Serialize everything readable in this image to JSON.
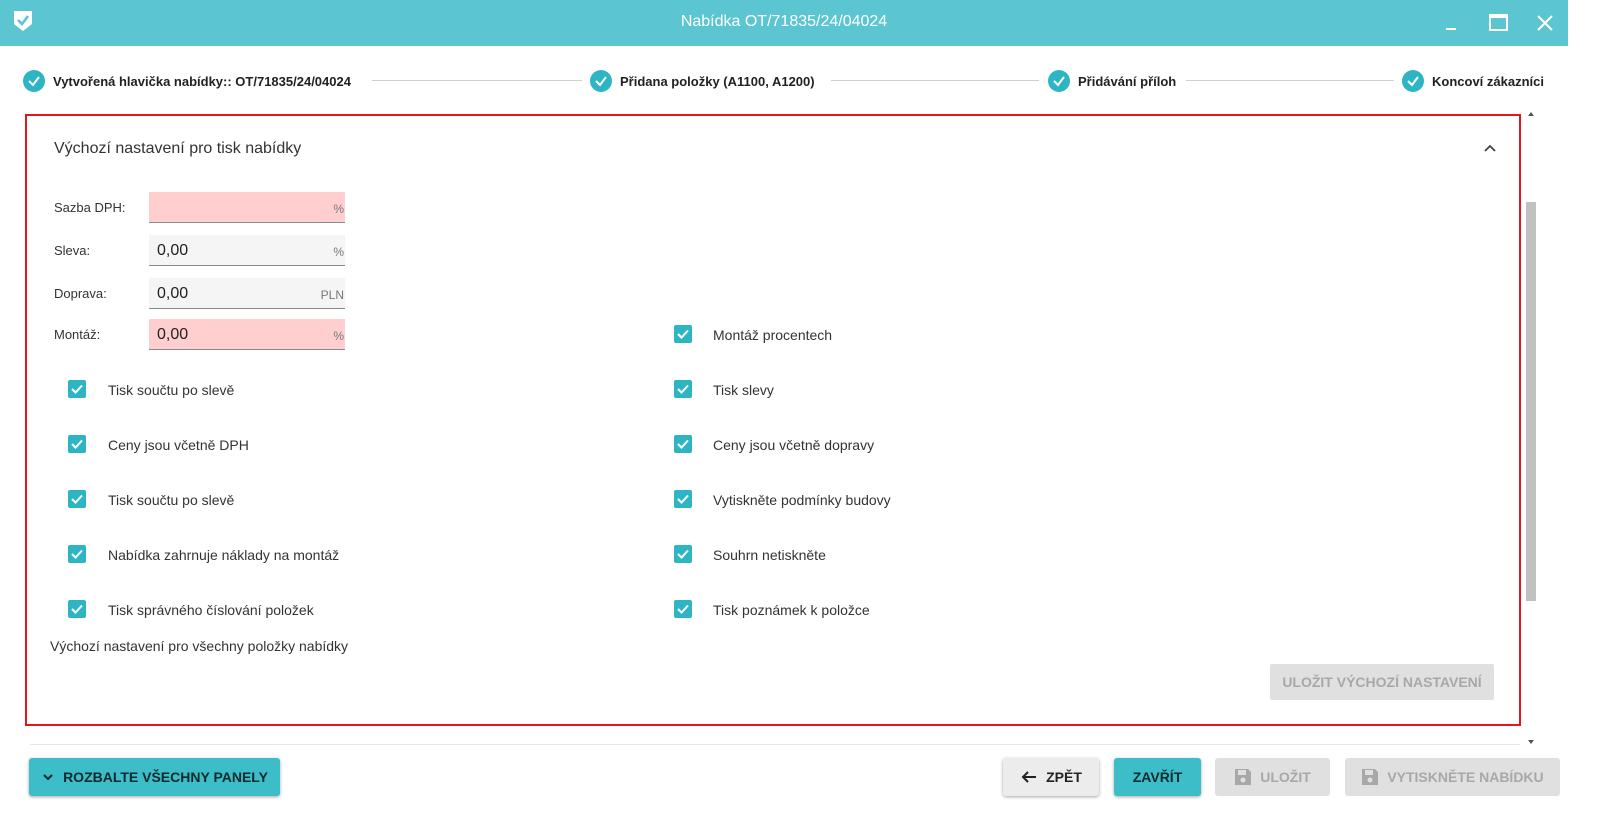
{
  "window": {
    "title": "Nabídka OT/71835/24/04024",
    "app_icon": "check-shield-icon",
    "controls": [
      "minimize-icon",
      "maximize-icon",
      "close-icon"
    ]
  },
  "stepper": {
    "steps": [
      {
        "label": "Vytvořená hlavička nabídky:: OT/71835/24/04024",
        "icon": "check-circle-icon",
        "done": true
      },
      {
        "label": "Přidana položky (A1100, A1200)",
        "icon": "check-circle-icon",
        "done": true
      },
      {
        "label": "Přidávání příloh",
        "icon": "check-circle-icon",
        "done": true
      },
      {
        "label": "Koncoví zákazníci",
        "icon": "check-circle-icon",
        "done": true
      }
    ]
  },
  "panel": {
    "title": "Výchozí nastavení pro tisk nabídky",
    "collapse_icon": "chevron-up-icon",
    "fields": [
      {
        "label": "Sazba DPH:",
        "value": "",
        "unit": "%",
        "error": true
      },
      {
        "label": "Sleva:",
        "value": "0,00",
        "unit": "%",
        "error": false
      },
      {
        "label": "Doprava:",
        "value": "0,00",
        "unit": "PLN",
        "error": false
      },
      {
        "label": "Montáž:",
        "value": "0,00",
        "unit": "%",
        "error": true
      }
    ],
    "montaz_checkbox": {
      "label": "Montáž procentech",
      "checked": true
    },
    "checkboxes_left": [
      {
        "label": "Tisk součtu po slevě",
        "checked": true
      },
      {
        "label": "Ceny jsou včetně DPH",
        "checked": true
      },
      {
        "label": "Tisk součtu po slevě",
        "checked": true
      },
      {
        "label": "Nabídka zahrnuje náklady na montáž",
        "checked": true
      },
      {
        "label": "Tisk správného číslování položek",
        "checked": true
      }
    ],
    "checkboxes_right": [
      {
        "label": "Tisk slevy",
        "checked": true
      },
      {
        "label": "Ceny jsou včetně dopravy",
        "checked": true
      },
      {
        "label": "Vytiskněte podmínky budovy",
        "checked": true
      },
      {
        "label": "Souhrn netiskněte",
        "checked": true
      },
      {
        "label": "Tisk poznámek k položce",
        "checked": true
      }
    ],
    "footer_text": "Výchozí nastavení pro všechny položky nabídky",
    "save_default_label": "ULOŽIT VÝCHOZÍ NASTAVENÍ"
  },
  "actions": {
    "expand_all": {
      "label": "ROZBALTE VŠECHNY PANELY",
      "icon": "chevron-down-icon"
    },
    "back": {
      "label": "ZPĚT",
      "icon": "arrow-left-icon"
    },
    "close": {
      "label": "ZAVŘÍT"
    },
    "save": {
      "label": "ULOŽIT",
      "icon": "floppy-disk-icon",
      "disabled": true
    },
    "print": {
      "label": "VYTISKNĚTE NABÍDKU",
      "icon": "floppy-disk-icon",
      "disabled": true
    }
  },
  "colors": {
    "accent": "#5bc6d1",
    "checkbox": "#2eb5c4",
    "error_field": "#ffcfcf",
    "highlight_border": "#e0171d"
  }
}
